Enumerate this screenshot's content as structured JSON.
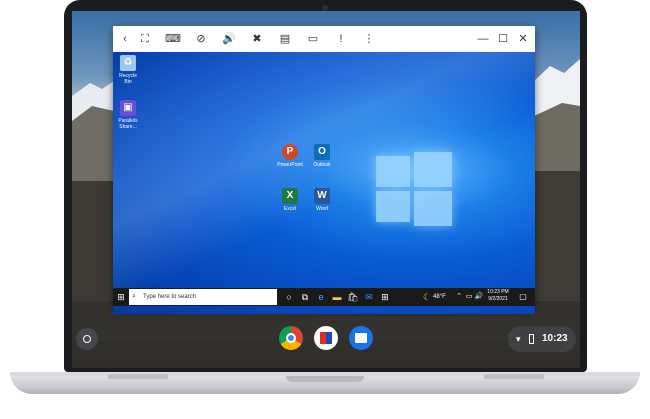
{
  "vm_toolbar": {
    "icons": [
      "back-icon",
      "fullscreen-icon",
      "keyboard-icon",
      "camera-off-icon",
      "volume-icon",
      "mic-off-icon",
      "print-icon",
      "folder-icon",
      "feedback-icon",
      "more-icon"
    ],
    "window_controls": [
      "minimize-icon",
      "maximize-icon",
      "close-icon"
    ]
  },
  "windows_desktop": {
    "icons": [
      {
        "name": "recycle-bin",
        "label": "Recycle Bin",
        "color": "#9fc6e8"
      },
      {
        "name": "parallels-share",
        "label": "Parallels Share...",
        "color": "#6a4fd6"
      },
      {
        "name": "powerpoint",
        "label": "PowerPoint",
        "color": "#d24726"
      },
      {
        "name": "outlook",
        "label": "Outlook",
        "color": "#0f6cbd"
      },
      {
        "name": "excel",
        "label": "Excel",
        "color": "#1d7a45"
      },
      {
        "name": "word",
        "label": "Word",
        "color": "#2b579a"
      }
    ],
    "taskbar": {
      "search_placeholder": "Type here to search",
      "weather": "48°F",
      "time": "10:23 PM",
      "date": "9/2/2021"
    }
  },
  "chromeos_shelf": {
    "apps": [
      "chrome",
      "parallels-desktop",
      "files"
    ],
    "time": "10:23"
  },
  "colors": {
    "win_blue": "#0a5bd6",
    "bezel": "#1b1c1e",
    "shelf_tray": "#3f4143"
  }
}
